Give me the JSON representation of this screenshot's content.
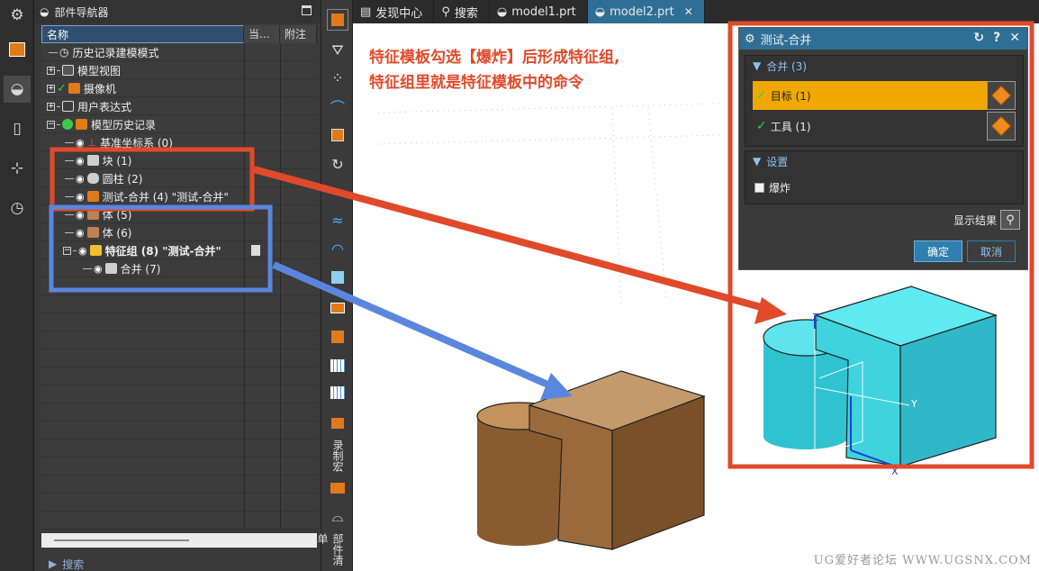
{
  "navigator": {
    "title": "部件导航器",
    "columns": {
      "name": "名称",
      "current": "当...",
      "note": "附注"
    },
    "tree": [
      {
        "label": "历史记录建模模式"
      },
      {
        "label": "模型视图"
      },
      {
        "label": "摄像机"
      },
      {
        "label": "用户表达式"
      },
      {
        "label": "模型历史记录"
      },
      {
        "label": "基准坐标系 (0)"
      },
      {
        "label": "块 (1)"
      },
      {
        "label": "圆柱 (2)"
      },
      {
        "label": "测试-合并 (4) \"测试-合并\""
      },
      {
        "label": "体 (5)"
      },
      {
        "label": "体 (6)"
      },
      {
        "label": "特征组 (8) \"测试-合并\""
      },
      {
        "label": "合并 (7)"
      }
    ],
    "search": "搜索"
  },
  "toolbar": {
    "vertical_text_1": "录制宏",
    "vertical_text_2": "部件清单"
  },
  "tabs": [
    {
      "label": "发现中心"
    },
    {
      "label": "搜索"
    },
    {
      "label": "model1.prt"
    },
    {
      "label": "model2.prt"
    }
  ],
  "annotation": {
    "line1": "特征模板勾选【爆炸】后形成特征组,",
    "line2": "特征组里就是特征模板中的命令"
  },
  "dialog": {
    "title": "测试-合并",
    "section_merge": "合并 (3)",
    "target": "目标 (1)",
    "tool": "工具 (1)",
    "section_settings": "设置",
    "explode": "爆炸",
    "show_result": "显示结果",
    "ok": "确定",
    "cancel": "取消"
  },
  "axes": {
    "z": "Z",
    "y": "Y",
    "x": "X"
  },
  "watermark": "UG爱好者论坛 WWW.UGSNX.COM",
  "colors": {
    "accent": "#2f6f95",
    "highlight": "#f0a800",
    "red_frame": "#e04a2a",
    "blue_frame": "#5b86dd",
    "cyan_solid": "#2fd3e0",
    "brown_solid": "#b07a48"
  }
}
